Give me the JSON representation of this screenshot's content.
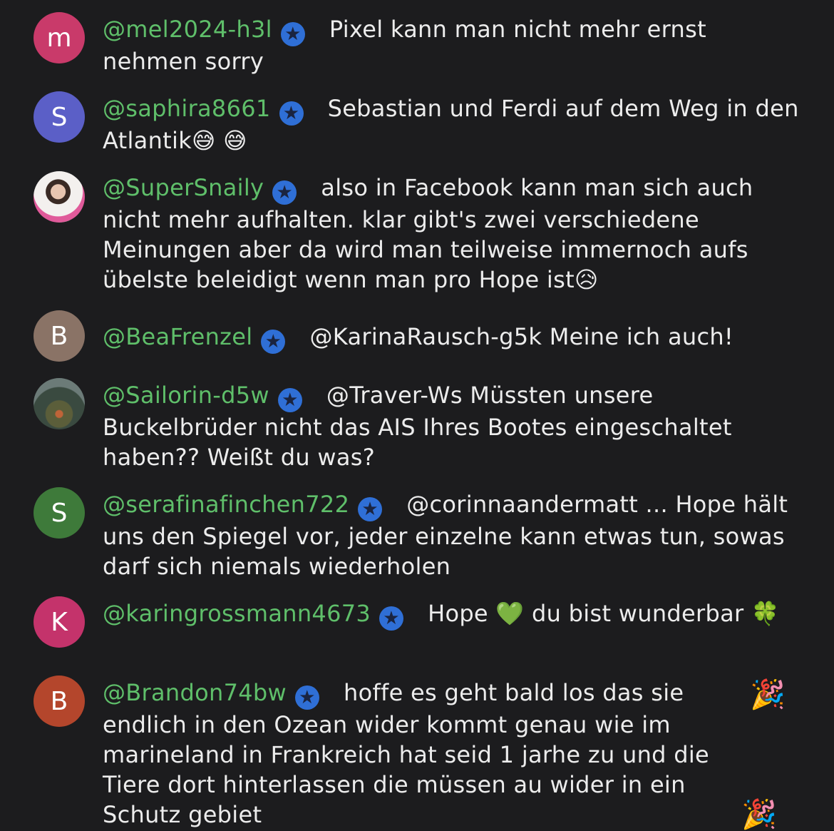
{
  "comments": [
    {
      "avatar_letter": "m",
      "avatar_color": "#c93a6a",
      "username": "@mel2024-h3l",
      "text": "Pixel kann man nicht mehr ernst nehmen sorry"
    },
    {
      "avatar_letter": "S",
      "avatar_color": "#5b5fc7",
      "username": "@saphira8661",
      "text": "Sebastian und Ferdi auf dem Weg in den Atlantik😅 😅"
    },
    {
      "avatar_letter": "",
      "avatar_color": "#444444",
      "username": "@SuperSnaily",
      "text": "also in Facebook kann man sich auch nicht mehr aufhalten. klar gibt's zwei verschiedene Meinungen aber da wird man teilweise immernoch aufs übelste beleidigt wenn man pro Hope ist😥"
    },
    {
      "avatar_letter": "B",
      "avatar_color": "#8a7366",
      "username": "@BeaFrenzel",
      "text": "@KarinaRausch-g5k Meine ich auch!"
    },
    {
      "avatar_letter": "",
      "avatar_color": "#3b4a42",
      "username": "@Sailorin-d5w",
      "text": "@Traver-Ws Müssten unsere Buckelbrüder nicht das AIS Ihres Bootes eingeschaltet haben?? Weißt du was?"
    },
    {
      "avatar_letter": "S",
      "avatar_color": "#3e7a3a",
      "username": "@serafinafinchen722",
      "text": "@corinnaandermatt ... Hope hält uns den Spiegel vor, jeder einzelne kann etwas tun, sowas darf sich niemals wiederholen"
    },
    {
      "avatar_letter": "K",
      "avatar_color": "#c4336b",
      "username": "@karingrossmann4673",
      "text": "Hope 💚 du bist wunderbar 🍀"
    },
    {
      "avatar_letter": "B",
      "avatar_color": "#b4462c",
      "username": "@Brandon74bw",
      "text": "hoffe es geht bald los das sie endlich in den Ozean wider kommt genau wie im marineland in Frankreich hat seid 1 jarhe zu und die Tiere dort hinterlassen die müssen au wider in ein Schutz gebiet"
    }
  ],
  "badge_icon": "verified-star-badge-icon",
  "confetti_icon": "🎉"
}
